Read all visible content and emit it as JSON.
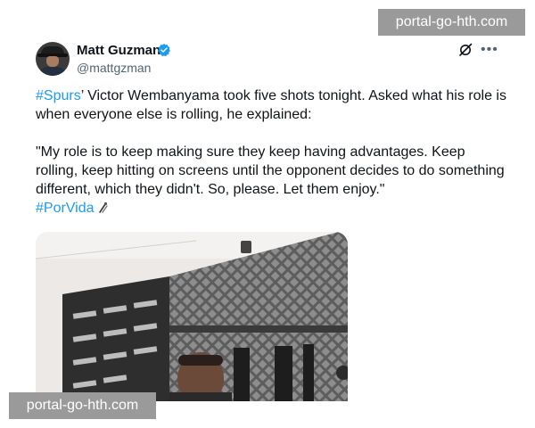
{
  "tweet": {
    "author": {
      "display_name": "Matt Guzman",
      "handle": "@mattgzman"
    },
    "icons": {
      "verified": "verified-badge-icon",
      "grok": "grok-icon",
      "more": "more-options-icon"
    },
    "text": {
      "line1_hashtag": "#Spurs",
      "line1_rest": "’ Victor Wembanyama took five shots tonight. Asked what his role is when everyone else is rolling, he explained:",
      "quote": "\"My role is to keep making sure they keep having advantages. Keep rolling, keep hitting on screens until the opponent decides to do something different, which they didn't. So, please. Let them enjoy.\"",
      "closing_hashtag": "#PorVida"
    },
    "media": {
      "description_icon": "photo-press-conference"
    }
  },
  "watermarks": {
    "top": "portal-go-hth.com",
    "bottom": "portal-go-hth.com"
  },
  "colors": {
    "hashtag": "#1d9bf0",
    "verified": "#1d9bf0",
    "watermark_bg": "#9a9a9a"
  }
}
